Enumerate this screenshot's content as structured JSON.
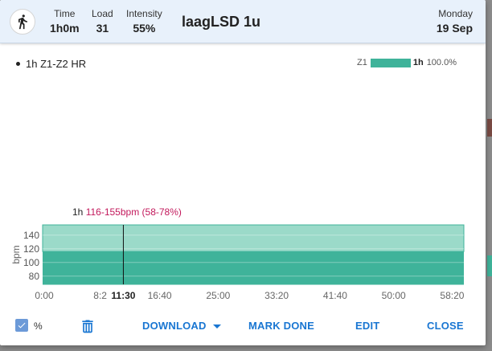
{
  "header": {
    "stats": [
      {
        "label": "Time",
        "value": "1h0m"
      },
      {
        "label": "Load",
        "value": "31"
      },
      {
        "label": "Intensity",
        "value": "55%"
      }
    ],
    "title": "laagLSD 1u",
    "day": "Monday",
    "date": "19 Sep"
  },
  "description": "1h Z1-Z2 HR",
  "zone_summary": {
    "zone": "Z1",
    "duration": "1h",
    "percent": "100.0%"
  },
  "interval": {
    "duration": "1h",
    "range": "116-155bpm (58-78%)"
  },
  "chart_data": {
    "type": "area",
    "ylabel": "bpm",
    "ylim": [
      68,
      155
    ],
    "yticks": [
      80,
      100,
      120,
      140
    ],
    "x_ticks": [
      "0:00",
      "8:2",
      "11:30",
      "16:40",
      "25:00",
      "33:20",
      "41:40",
      "50:00",
      "58:20"
    ],
    "cursor_label": "11:30",
    "series": [
      {
        "name": "",
        "start_min": 0,
        "end_min": 60,
        "low": 116,
        "high": 155
      }
    ],
    "colors": {
      "low_band": "#3fb39a",
      "high_band": "#9bdac9"
    }
  },
  "footer": {
    "percent_label": "%",
    "percent_checked": true,
    "download": "DOWNLOAD",
    "mark_done": "MARK DONE",
    "edit": "EDIT",
    "close": "CLOSE"
  }
}
